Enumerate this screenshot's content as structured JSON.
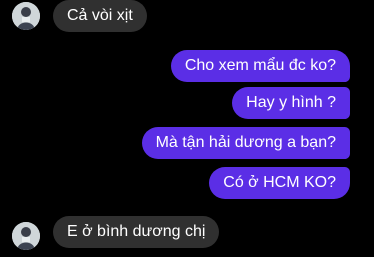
{
  "colors": {
    "background": "#000000",
    "incoming_bubble": "#303030",
    "outgoing_bubble": "#5b2ee6",
    "text": "#ffffff"
  },
  "messages": [
    {
      "direction": "incoming",
      "text": "Cả vòi xịt",
      "avatar_icon": "contact-avatar-icon"
    },
    {
      "direction": "outgoing",
      "text": "Cho xem mẩu đc ko?"
    },
    {
      "direction": "outgoing",
      "text": "Hay y hình ?"
    },
    {
      "direction": "outgoing",
      "text": "Mà tận hải dương a bạn?"
    },
    {
      "direction": "outgoing",
      "text": "Có ở HCM KO?"
    },
    {
      "direction": "incoming",
      "text": "E ở bình dương chị",
      "avatar_icon": "contact-avatar-icon"
    }
  ]
}
